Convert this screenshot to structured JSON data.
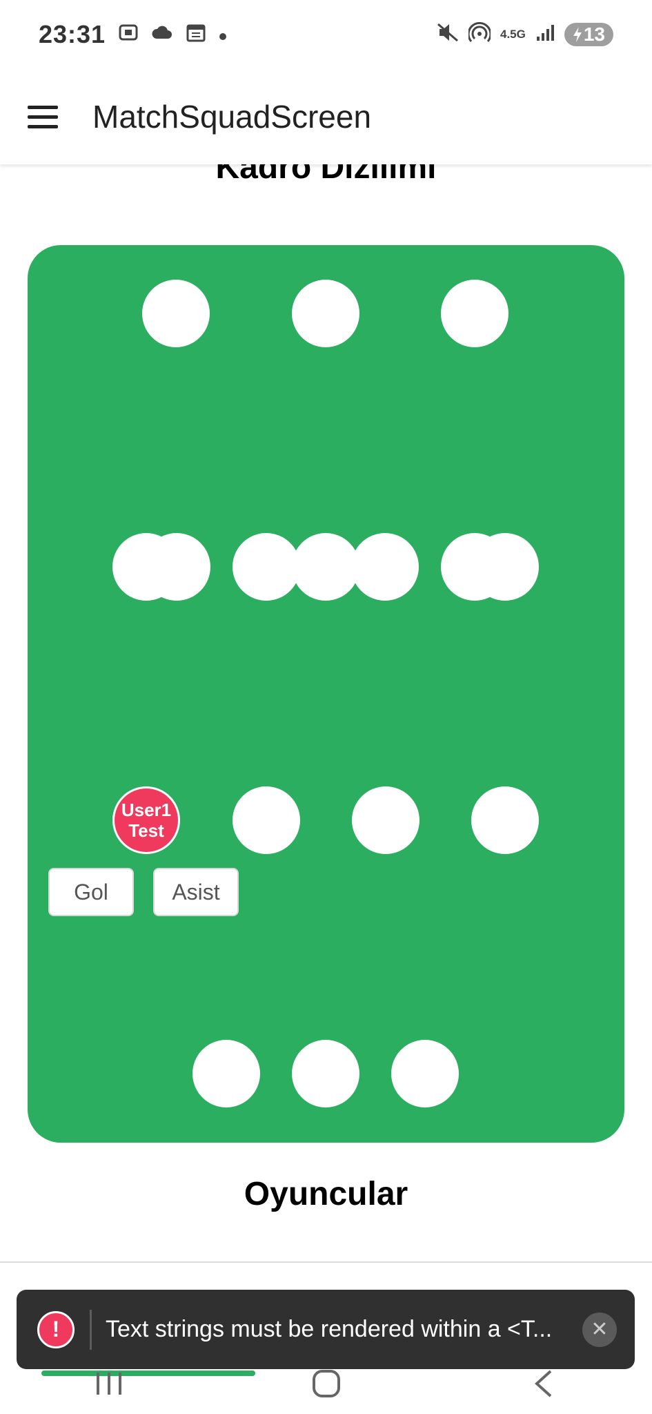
{
  "status_bar": {
    "time": "23:31",
    "network": "4.5G",
    "battery": "13",
    "left_icons": [
      "screenshot-icon",
      "cloud-icon",
      "calendar-icon",
      "dot-icon"
    ],
    "right_icons": [
      "mute-icon",
      "hotspot-icon",
      "signal-icon",
      "battery-icon"
    ]
  },
  "app_bar": {
    "title": "MatchSquadScreen",
    "menu_icon": "hamburger-menu-icon"
  },
  "formation": {
    "title": "Kadro Dizilimi",
    "pitch_color": "#2cae60",
    "selected_player": {
      "line1": "User1",
      "line2": "Test",
      "color": "#ef3a5d"
    },
    "stat_buttons": {
      "goal_label": "Gol",
      "assist_label": "Asist"
    }
  },
  "players_section": {
    "title": "Oyuncular"
  },
  "toast": {
    "message": "Text strings must be rendered within a <T...",
    "icon": "error-icon",
    "close_icon": "close-icon"
  },
  "nav_bar": {
    "buttons": [
      "recent-apps-icon",
      "home-icon",
      "back-icon"
    ]
  }
}
